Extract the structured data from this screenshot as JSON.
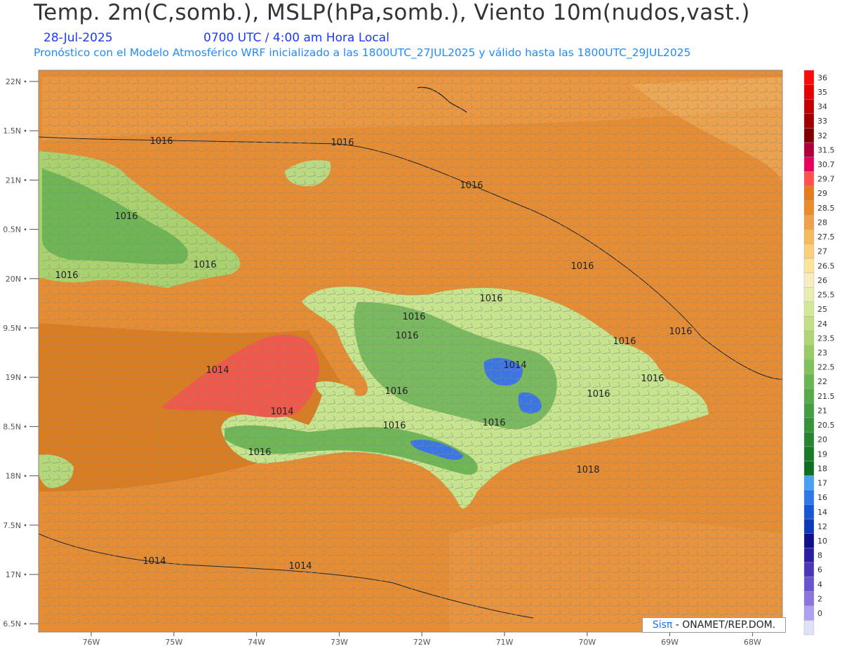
{
  "header": {
    "title": "Temp. 2m(C,somb.), MSLP(hPa,somb.), Viento 10m(nudos,vast.)",
    "date": "28-Jul-2025",
    "time": "0700 UTC / 4:00 am Hora Local",
    "subtitle": "Pronóstico con el Modelo Atmosférico WRF inicializado a las 1800UTC_27JUL2025 y válido hasta las  1800UTC_29JUL2025"
  },
  "credit": {
    "logo": "Sisπ",
    "text": " - ONAMET/REP.DOM."
  },
  "axes": {
    "lat_labels": [
      "22N",
      "1.5N",
      "21N",
      "0.5N",
      "20N",
      "9.5N",
      "19N",
      "8.5N",
      "18N",
      "7.5N",
      "17N",
      "6.5N"
    ],
    "lon_labels": [
      "76W",
      "75W",
      "74W",
      "73W",
      "72W",
      "71W",
      "70W",
      "69W",
      "68W"
    ]
  },
  "colorbar": {
    "labels": [
      "36",
      "35",
      "34",
      "33",
      "32",
      "31.5",
      "30.7",
      "29.7",
      "29",
      "28.5",
      "28",
      "27.5",
      "27",
      "26.5",
      "26",
      "25.5",
      "25",
      "24",
      "23.5",
      "23",
      "22.5",
      "22",
      "21.5",
      "21",
      "20.5",
      "20",
      "19",
      "18",
      "17",
      "16",
      "14",
      "12",
      "10",
      "8",
      "6",
      "4",
      "2",
      "0"
    ],
    "colors": [
      "#ff0a0a",
      "#e30000",
      "#c20000",
      "#a10000",
      "#800000",
      "#b0003c",
      "#e8005f",
      "#ff4f4f",
      "#e47b1c",
      "#ea8c2e",
      "#f0a14a",
      "#f5b95e",
      "#f8cf7b",
      "#fbe59c",
      "#f7ebc0",
      "#e8eeb0",
      "#d4e89a",
      "#c2df88",
      "#aed676",
      "#97cb66",
      "#80c15a",
      "#6ab650",
      "#56ab48",
      "#439e40",
      "#349238",
      "#268530",
      "#1a7a28",
      "#0f6e22",
      "#4aa0f0",
      "#2d7ae6",
      "#1658d4",
      "#0a3ab8",
      "#10108a",
      "#2a1fa0",
      "#4a38b8",
      "#6b54cf",
      "#8a74e0",
      "#b0a0f0",
      "#e0e0f8"
    ]
  },
  "isobars": [
    "1016",
    "1016",
    "1016",
    "1016",
    "1016",
    "1016",
    "1016",
    "1016",
    "1016",
    "1016",
    "1016",
    "1016",
    "1016",
    "1016",
    "1016",
    "1016",
    "1016",
    "1016",
    "1018",
    "1014",
    "1014",
    "1014",
    "1014",
    "1014"
  ],
  "colors": {
    "sea": "#e4892f",
    "land_low": "#c8e18e",
    "land_high": "#4e9e47",
    "hot": "#f05a4a",
    "cold": "#3a78e0"
  }
}
